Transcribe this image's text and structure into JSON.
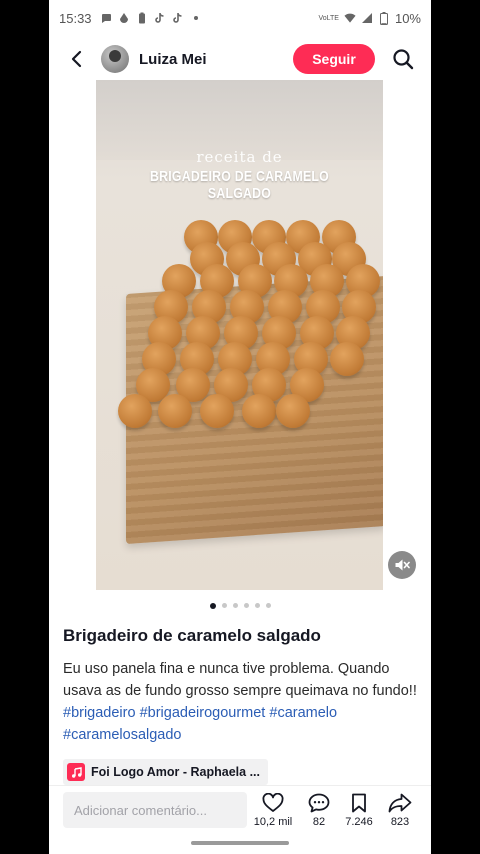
{
  "status_bar": {
    "time": "15:33",
    "network_label": "VoLTE",
    "battery": "10%"
  },
  "header": {
    "username": "Luiza Mei",
    "follow_label": "Seguir"
  },
  "media": {
    "overlay_subtitle": "receita de",
    "overlay_title": "BRIGADEIRO DE CARAMELO SALGADO",
    "carousel_count": 6,
    "carousel_active_index": 0
  },
  "post": {
    "title": "Brigadeiro de caramelo salgado",
    "description": "Eu uso panela fina e nunca tive problema. Quando usava as de fundo grosso sempre queimava no fundo!!",
    "hashtags": [
      "#brigadeiro",
      "#brigadeirogourmet",
      "#caramelo",
      "#caramelosalgado"
    ]
  },
  "music": {
    "label": "Foi Logo Amor - Raphaela ..."
  },
  "bottom_bar": {
    "comment_placeholder": "Adicionar comentário...",
    "likes": "10,2 mil",
    "comments": "82",
    "saves": "7.246",
    "shares": "823"
  },
  "colors": {
    "accent": "#fe2c55",
    "hashtag": "#2b5db5",
    "text": "#161823"
  }
}
